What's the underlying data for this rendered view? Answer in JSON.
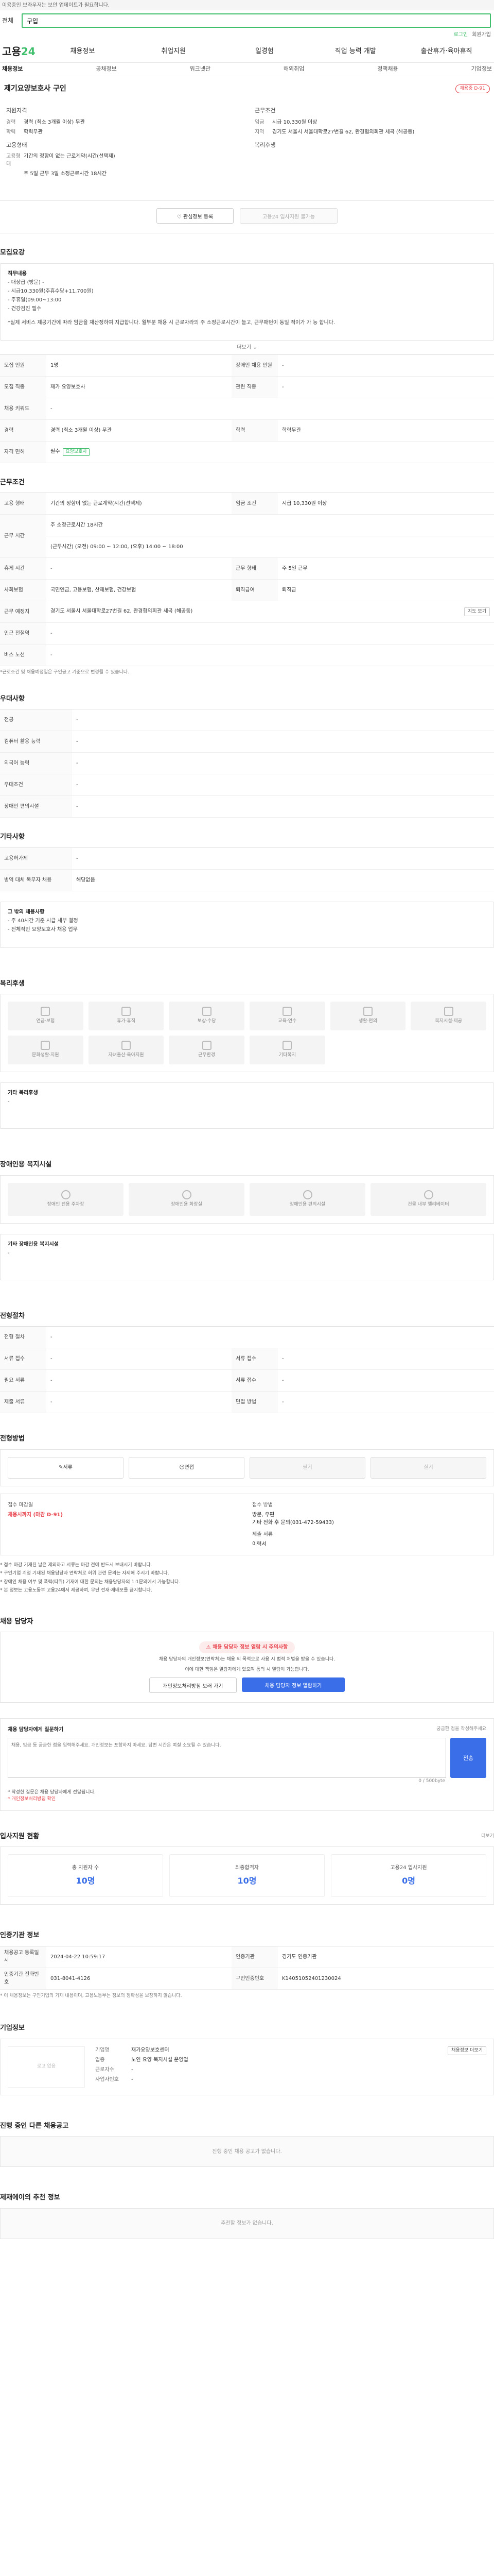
{
  "notice": "이용중인 브라우저는 보안 업데이트가 필요합니다.",
  "search": {
    "scope": "전체",
    "value": "구입"
  },
  "util": {
    "login": "로그인",
    "join": "회원가입"
  },
  "gnb": {
    "logo_a": "고용",
    "logo_b": "24",
    "menu": [
      "채용정보",
      "취업지원",
      "일경험",
      "직업 능력 개발",
      "출산휴가·육아휴직"
    ]
  },
  "subnav": [
    "채용정보",
    "공채정보",
    "워크넷관",
    "해외취업",
    "정책채용",
    "기업정보"
  ],
  "job": {
    "title": "제기요양보호사 구인",
    "badge": "채용중 D-91"
  },
  "summary": {
    "left_title": "지원자격",
    "left": [
      {
        "k": "경력",
        "v": "경력 (최소 3개월 이상) 무관"
      },
      {
        "k": "학력",
        "v": "학력무관"
      }
    ],
    "left_title2": "고용형태",
    "left2": [
      {
        "k": "고용형태",
        "v": "기간의 정함이 없는 근로계약(시간(선택제)"
      },
      {
        "k": "",
        "v": "주 5일 근무 3일 소정근로시간 18시간"
      }
    ],
    "right_title": "근무조건",
    "right": [
      {
        "k": "임금",
        "v": "시급 10,330원 이상"
      },
      {
        "k": "지역",
        "v": "경기도 서울시 서울대학로27번길 62, 완경협의회관 세곡 (해공동)"
      }
    ],
    "right_title2": "복리후생",
    "right2": []
  },
  "actions": {
    "interest": "관심정보 등록",
    "apply": "고용24 입사지원 불가능"
  },
  "recruit": {
    "title": "모집요강",
    "box_title": "직무내용",
    "lines": [
      "- 대상급 (방문) -",
      "- 시급10,330원(주휴수당+11,700원)",
      "- 주휴일(09:00~13:00",
      "- 건강검진 필수"
    ],
    "warning": "*실제 서비스 제공기간에 따라 임금을 재산정하여 지급합니다. 월부분 채용 시 근로자라의 주 소정근로시간이 늘고, 근무패턴이 동일 적이가 가 능 합니다.",
    "more": "더보기"
  },
  "recruit_table": [
    {
      "k": "모집 인원",
      "v": "1명",
      "k2": "장애인 채용 인원",
      "v2": "-"
    },
    {
      "k": "모집 직종",
      "v": "재가 요양보호사",
      "k2": "관련 직종",
      "v2": "-"
    },
    {
      "k": "채용 키워드",
      "v": "-",
      "k2": "",
      "v2": ""
    },
    {
      "k": "경력",
      "v": "경력 (최소 3개월 이상) 무관",
      "k2": "학력",
      "v2": "학력무관"
    },
    {
      "k": "자격 면허",
      "v": "필수",
      "chip": "요양보호사",
      "k2": "",
      "v2": ""
    }
  ],
  "work": {
    "title": "근무조건",
    "rows": [
      {
        "k": "고용 형태",
        "v": "기간의 정함이 없는 근로계약(시간(선택제)",
        "k2": "임금 조건",
        "v2": "시급 10,330원 이상"
      },
      {
        "k": "근무 시간",
        "v": "주 소정근로시간 18시간",
        "k2": "",
        "v2": ""
      },
      {
        "k": "",
        "v": "(근무시간) (오전) 09:00 ~ 12:00, (오후) 14:00 ~ 18:00",
        "k2": "",
        "v2": ""
      },
      {
        "k": "휴게 시간",
        "v": "-",
        "k2": "근무 형태",
        "v2": "주 5일 근무"
      },
      {
        "k": "사회보험",
        "v": "국민연금, 고용보험, 산재보험, 건강보험",
        "k2": "퇴직급여",
        "v2": "퇴직금"
      },
      {
        "k": "근무 예정지",
        "v": "경기도 서울시 서울대학로27번길 62, 완경협의회관 세곡 (해공동)",
        "k2": "",
        "v2": "",
        "btn": "지도 보기"
      },
      {
        "k": "인근 전철역",
        "v": "-",
        "k2": "",
        "v2": ""
      },
      {
        "k": "버스 노선",
        "v": "-",
        "k2": "",
        "v2": ""
      }
    ],
    "note": "*근로조건 및 채용예정일은 구인공고 기준으로 변경될 수 있습니다."
  },
  "preference": {
    "title": "우대사항",
    "rows": [
      {
        "k": "전공",
        "v": "-"
      },
      {
        "k": "컴퓨터 활용 능력",
        "v": "-"
      },
      {
        "k": "외국어 능력",
        "v": "-"
      },
      {
        "k": "우대조건",
        "v": "-"
      },
      {
        "k": "장애인 편의시설",
        "v": "-"
      }
    ]
  },
  "etc": {
    "title": "기타사항",
    "rows": [
      {
        "k": "고용허가제",
        "v": "-"
      },
      {
        "k": "병역 대체 복무자 채용",
        "v": "해당없음"
      }
    ],
    "box": [
      "그 밖의 채용사항",
      "- 주 40시간 기준 시급 세부 결정",
      "- 전체적인 요양보호사 채용 업무"
    ]
  },
  "welfare": {
    "title": "복리후생",
    "tiles": [
      "연금·보험",
      "휴가·휴직",
      "보상·수당",
      "교육·연수",
      "생활·편의",
      "복지시설·제공",
      "문화생활·지원",
      "자녀출산·육아지원",
      "근무환경",
      "기타복지"
    ],
    "detail_title": "기타 복리후생",
    "detail": "-"
  },
  "disabled": {
    "title": "장애인용 복지시설",
    "tiles": [
      "장애인 전용 주차장",
      "장애인용 화장실",
      "장애인용 편의시설",
      "건물 내부 엘리베이터"
    ],
    "detail_title": "기타 장애인용 복지시설",
    "detail": "-"
  },
  "process": {
    "title": "전형절차",
    "rows": [
      {
        "k": "전형 절차",
        "v": "-",
        "k2": "",
        "v2": ""
      },
      {
        "k": "서류 접수",
        "v": "-",
        "k2": "서류 접수",
        "v2": "-"
      },
      {
        "k": "필요 서류",
        "v": "-",
        "k2": "서류 접수",
        "v2": "-"
      },
      {
        "k": "제출 서류",
        "v": "-",
        "k2": "면접 방법",
        "v2": "-"
      }
    ]
  },
  "method": {
    "title": "전형방법",
    "steps": [
      "서류",
      "면접",
      "필기",
      "실기"
    ],
    "period_label": "접수 마감일",
    "period": "채용시까지 (마감 D-91)",
    "place_label": "접수 방법",
    "place": "방문, 우편",
    "addr": "기타 전화 후 문의(031-472-59433)",
    "contact_label": "제출 서류",
    "contact": "이력서"
  },
  "method_notes": [
    "* 접수 마감 기재된 날은 제외하고 서류는 마감 전에 반드시 보내시기 바랍니다.",
    "* 구인기업 계정 기재된 채용담당자 연락처로 허위 관련 문의는 자제해 주시기 바랍니다.",
    "* 장애인 채용 여부 및 폭력(따위) 기재에 대한 문의는 채용담당자의 1:1문의에서 가능합니다.",
    "* 본 정보는 고용노동부 고용24에서 제공하며, 무단 전재·재배포를 금지합니다."
  ],
  "recruiter": {
    "title": "채용 담당자",
    "warn": "채용 담당자 정보 열람 시 주의사항",
    "p1": "채용 담당자의 개인정보(연락처)는 채용 외 목적으로 사용 시 법적 처벌을 받을 수 있습니다.",
    "p2": "이에 대한 책임은 열람자에게 있으며 동의 시 열람이 가능합니다.",
    "b1": "개인정보처리방침 보러 가기",
    "b2": "채용 담당자 정보 열람하기"
  },
  "qa": {
    "title": "채용 담당자에게 질문하기",
    "sub": "궁금한 점을 작성해주세요",
    "placeholder": "채용, 임금 등 궁금한 점을 입력해주세요. 개인정보는 포함하지 마세요. 답변 시간은 며칠 소요될 수 있습니다.",
    "counter": "0 / 500byte",
    "submit": "전송",
    "notes": [
      "* 작성한 질문은 채용 담당자에게 전달됩니다.",
      "* 개인정보처리방침 확인"
    ]
  },
  "stats": {
    "title": "입사지원 현황",
    "more": "더보기",
    "items": [
      {
        "l": "총 지원자 수",
        "n": "10명"
      },
      {
        "l": "최종합격자",
        "n": "10명"
      },
      {
        "l": "고용24 입사지원",
        "n": "0명"
      }
    ]
  },
  "info": {
    "title": "인증기관 정보",
    "rows": [
      {
        "k": "채용공고 등록일시",
        "v": "2024-04-22 10:59:17",
        "k2": "인증기관",
        "v2": "경기도 인증기관"
      },
      {
        "k": "인증기관 전화번호",
        "v": "031-8041-4126",
        "k2": "구인인증번호",
        "v2": "K14051052401230024"
      }
    ],
    "note": "* 이 채용정보는 구인기업의 기재 내용이며, 고용노동부는 정보의 정확성을 보장하지 않습니다."
  },
  "company": {
    "title": "기업정보",
    "logo": "로고 없음",
    "rows": [
      {
        "k": "기업명",
        "v": "재가요양보호센터"
      },
      {
        "k": "업종",
        "v": "노인 요양 복지시설 운영업"
      },
      {
        "k": "근로자수",
        "v": "-"
      },
      {
        "k": "사업자번호",
        "v": "-"
      }
    ],
    "btn": "채용정보 더보기"
  },
  "ongoing": {
    "title": "진행 중인 다른 채용공고",
    "empty": "진행 중인 채용 공고가 없습니다."
  },
  "recommend": {
    "title": "제재에이의 추천 정보",
    "empty": "추천할 정보가 없습니다."
  }
}
